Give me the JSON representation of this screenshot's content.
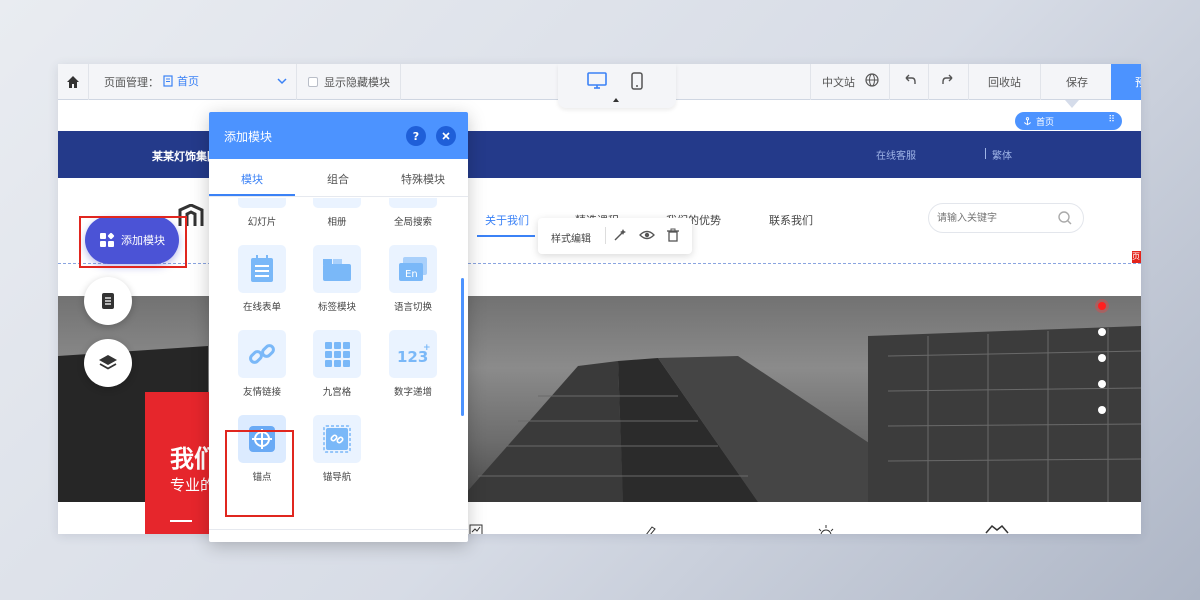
{
  "toolbar": {
    "page_manage_label": "页面管理：",
    "current_page": "首页",
    "show_hidden_label": "显示隐藏模块",
    "site_lang": "中文站",
    "recycle_label": "回收站",
    "save_label": "保存",
    "preview_label": "预"
  },
  "anchor_tag": {
    "label": "首页"
  },
  "site": {
    "company_name": "某某灯饰集团",
    "online_service": "在线客服",
    "traditional": "繁体",
    "nav": [
      "关于我们",
      "精选课程",
      "我们的优势",
      "联系我们"
    ],
    "search_placeholder": "请输入关键字",
    "red_mark": "页"
  },
  "hero": {
    "title": "我们",
    "subtitle": "专业的",
    "slides_count": 5,
    "active_slide": 1
  },
  "add_module_button": {
    "label": "添加模块"
  },
  "float_toolbar": {
    "label": "样式编辑"
  },
  "panel": {
    "title": "添加模块",
    "help": "?",
    "tabs": [
      "模块",
      "组合",
      "特殊模块"
    ],
    "active_tab": 0,
    "modules": [
      {
        "label": "幻灯片",
        "icon": "slideshow-icon"
      },
      {
        "label": "相册",
        "icon": "album-icon"
      },
      {
        "label": "全局搜索",
        "icon": "search-icon"
      },
      {
        "label": "在线表单",
        "icon": "form-icon"
      },
      {
        "label": "标签模块",
        "icon": "tabs-icon"
      },
      {
        "label": "语言切换",
        "icon": "language-icon"
      },
      {
        "label": "友情链接",
        "icon": "link-icon"
      },
      {
        "label": "九宫格",
        "icon": "grid-icon"
      },
      {
        "label": "数字递增",
        "icon": "number-icon"
      },
      {
        "label": "锚点",
        "icon": "anchor-target-icon"
      },
      {
        "label": "锚导航",
        "icon": "anchor-nav-icon"
      }
    ],
    "highlighted_module": "锚点"
  },
  "colors": {
    "accent": "#4c93ff",
    "header_blue": "#243a8a",
    "highlight_red": "#e0261f",
    "add_button": "#4b53d6"
  }
}
